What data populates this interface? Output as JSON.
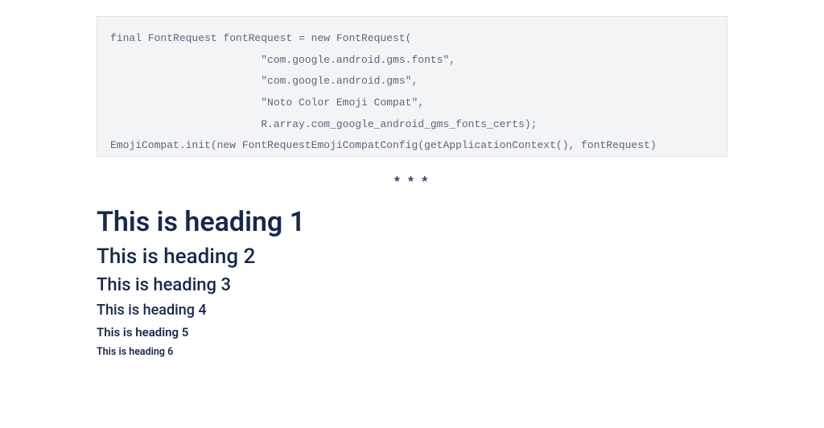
{
  "code": {
    "lines": [
      "final FontRequest fontRequest = new FontRequest(",
      "                        \"com.google.android.gms.fonts\",",
      "                        \"com.google.android.gms\",",
      "                        \"Noto Color Emoji Compat\",",
      "                        R.array.com_google_android_gms_fonts_certs);",
      "EmojiCompat.init(new FontRequestEmojiCompatConfig(getApplicationContext(), fontRequest)"
    ]
  },
  "divider": "* * *",
  "headings": {
    "h1": "This is heading 1",
    "h2": "This is heading 2",
    "h3": "This is heading 3",
    "h4": "This is heading 4",
    "h5": "This is heading 5",
    "h6": "This is heading 6"
  }
}
